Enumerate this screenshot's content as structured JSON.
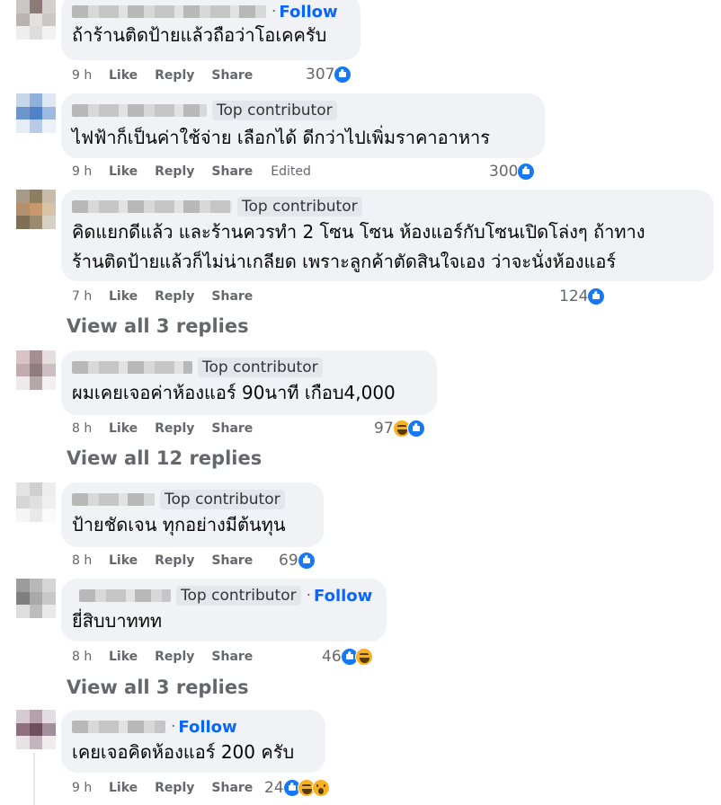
{
  "actions": {
    "like": "Like",
    "reply": "Reply",
    "share": "Share"
  },
  "comments": [
    {
      "badge": "",
      "follow": "Follow",
      "text": [
        "ถ้าร้านติดป้ายแล้วถือว่าโอเคครับ"
      ],
      "time": "9 h",
      "edited": "",
      "count": "307",
      "reactions": [
        "like-icon"
      ]
    },
    {
      "badge": "Top contributor",
      "follow": "",
      "text": [
        "ไฟฟ้าก็เป็นค่าใช้จ่าย เลือกได้ ดีกว่าไปเพิ่มราคาอาหาร"
      ],
      "time": "9 h",
      "edited": "Edited",
      "count": "300",
      "reactions": [
        "like-icon"
      ]
    },
    {
      "badge": "Top contributor",
      "follow": "",
      "text": [
        "คิดแยกดีแล้ว และร้านควรทำ 2 โซน โซน ห้องแอร์กับโซนเปิดโล่งๆ ถ้าทาง",
        "ร้านติดป้ายแล้วก็ไม่น่าเกลียด เพราะลูกค้าตัดสินใจเอง ว่าจะนั่งห้องแอร์"
      ],
      "time": "7 h",
      "edited": "",
      "count": "124",
      "reactions": [
        "like-icon"
      ]
    },
    {
      "badge": "Top contributor",
      "follow": "",
      "text": [
        "ผมเคยเจอค่าห้องแอร์ 90นาที เกือบ4,000"
      ],
      "time": "8 h",
      "edited": "",
      "count": "97",
      "reactions": [
        "haha-icon",
        "like-icon"
      ]
    },
    {
      "badge": "Top contributor",
      "follow": "",
      "text": [
        "ป้ายชัดเจน ทุกอย่างมีต้นทุน"
      ],
      "time": "8 h",
      "edited": "",
      "count": "69",
      "reactions": [
        "like-icon"
      ]
    },
    {
      "badge": "Top contributor",
      "follow": "Follow",
      "text": [
        "ยี่สิบบาททท"
      ],
      "time": "8 h",
      "edited": "",
      "count": "46",
      "reactions": [
        "like-icon",
        "haha-icon"
      ]
    },
    {
      "badge": "",
      "follow": "Follow",
      "text": [
        "เคยเจอคิดห้องแอร์ 200 ครับ"
      ],
      "time": "9 h",
      "edited": "",
      "count": "24",
      "reactions": [
        "like-icon",
        "haha-icon",
        "wow-icon"
      ]
    }
  ],
  "view_replies": [
    "View all 3 replies",
    "View all 12 replies",
    "View all 3 replies"
  ],
  "colors": {
    "bubble": "#f0f2f5",
    "link": "#0866ff",
    "secondary_text": "#65676b",
    "like": "#1877f2",
    "emoji": "#f7b125"
  }
}
